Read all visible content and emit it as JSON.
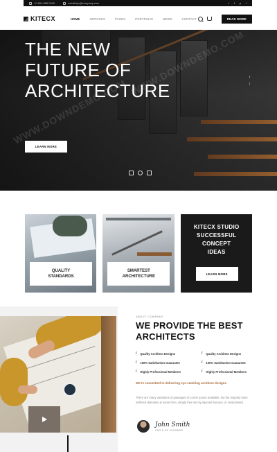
{
  "topbar": {
    "phone": "+0 664 888 0000",
    "email": "needhelp@company.com",
    "social": [
      "t",
      "f",
      "p",
      "i"
    ]
  },
  "nav": {
    "logo": "KITECX",
    "menu": [
      "HOME",
      "SERVICES",
      "PAGES",
      "PORTFOLIO",
      "NEWS",
      "CONTACT"
    ],
    "active": "HOME",
    "button": "READ MORE"
  },
  "hero": {
    "title_line1": "THE NEW",
    "title_line2": "FUTURE OF",
    "title_line3": "ARCHITECTURE",
    "button": "LEARN MORE",
    "arrow_up": "↑",
    "arrow_down": "↓"
  },
  "cards": [
    {
      "label_line1": "QUALITY",
      "label_line2": "STANDARDS"
    },
    {
      "label_line1": "SMARTEST",
      "label_line2": "ARCHITECTURE"
    },
    {
      "title_line1": "KITECX STUDIO",
      "title_line2": "SUCCESSFUL",
      "title_line3": "CONCEPT",
      "title_line4": "IDEAS",
      "button": "LEARN MORE"
    }
  ],
  "about": {
    "eyebrow": "ABOUT COMPANY",
    "title_line1": "WE PROVIDE THE BEST",
    "title_line2": "ARCHITECTS",
    "features": [
      "Quality Architect Designs",
      "Quality Architect Designs",
      "100% Satisfaction Guarantee",
      "100% Satisfaction Guarantee",
      "Highly Professional Members",
      "Highly Professional Members"
    ],
    "commit": "We're committed to delivering eye-catching architect designs",
    "paragraph": "There are many variations of passages of Lorem Ipsum available, but the majority have suffered alteration in some form, simply free text by injected humour, or randomised.",
    "signature": "John Smith",
    "role": "CEO & CO FOUNDER"
  },
  "watermark": "WWW.DOWNDEMO.COM",
  "colors": {
    "dark": "#111111",
    "accent": "#a86a3a",
    "stairs": "#8a5a33"
  }
}
